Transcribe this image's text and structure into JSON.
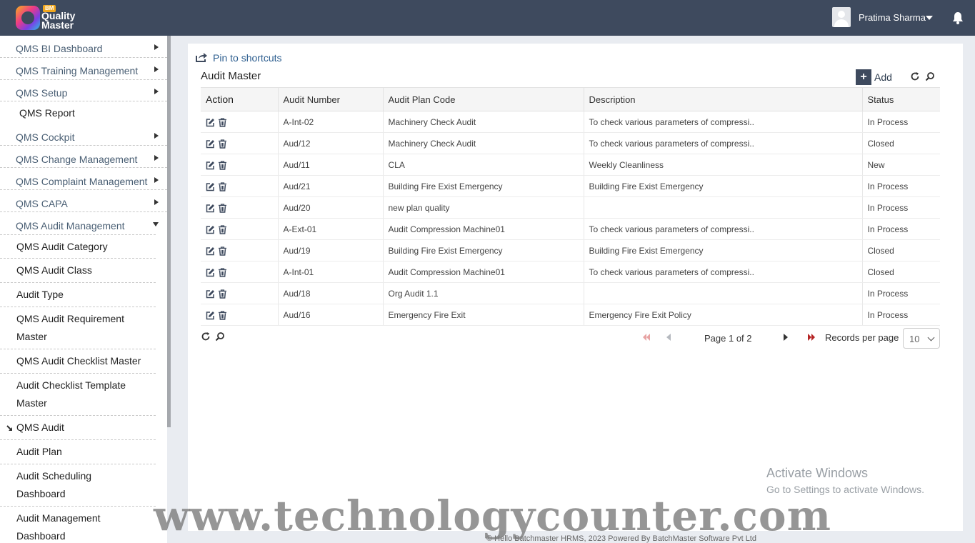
{
  "header": {
    "logo_badge": "BM",
    "logo_line1": "Quality",
    "logo_line2": "Master",
    "user_name": "Pratima Sharma",
    "icons": [
      "avatar-icon",
      "caret-down-icon",
      "bell-icon"
    ]
  },
  "sidebar": {
    "top_items": [
      {
        "label": "QMS BI Dashboard",
        "arrow": "right"
      },
      {
        "label": "QMS Training Management",
        "arrow": "right"
      },
      {
        "label": "QMS Setup",
        "arrow": "right"
      },
      {
        "label": "QMS Report",
        "arrow": "none"
      },
      {
        "label": "QMS Cockpit",
        "arrow": "right"
      },
      {
        "label": "QMS Change Management",
        "arrow": "right"
      },
      {
        "label": "QMS Complaint Management",
        "arrow": "right"
      },
      {
        "label": "QMS CAPA",
        "arrow": "right"
      },
      {
        "label": "QMS Audit Management",
        "arrow": "down"
      }
    ],
    "sub_items": [
      {
        "label": "QMS Audit Category"
      },
      {
        "label": "QMS Audit Class"
      },
      {
        "label": "Audit Type"
      },
      {
        "label": "QMS Audit Requirement",
        "label2": "Master"
      },
      {
        "label": "QMS Audit Checklist Master"
      },
      {
        "label": "Audit Checklist Template",
        "label2": "Master"
      },
      {
        "label": "QMS Audit",
        "active": true
      },
      {
        "label": "Audit Plan"
      },
      {
        "label": "Audit Scheduling",
        "label2": "Dashboard"
      },
      {
        "label": "Audit Management",
        "label2": "Dashboard"
      }
    ]
  },
  "main": {
    "pin_label": "Pin to shortcuts",
    "title": "Audit Master",
    "add_label": "Add",
    "table": {
      "headers": [
        "Action",
        "Audit Number",
        "Audit Plan Code",
        "Description",
        "Status"
      ],
      "rows": [
        [
          "A-Int-02",
          "Machinery Check Audit",
          "To check various parameters of compressi..",
          "In Process"
        ],
        [
          "Aud/12",
          "Machinery Check Audit",
          "To check various parameters of compressi..",
          "Closed"
        ],
        [
          "Aud/11",
          "CLA",
          "Weekly Cleanliness",
          "New"
        ],
        [
          "Aud/21",
          "Building Fire Exist Emergency",
          "Building Fire Exist Emergency",
          "In Process"
        ],
        [
          "Aud/20",
          "new plan quality",
          "",
          "In Process"
        ],
        [
          "A-Ext-01",
          "Audit Compression Machine01",
          "To check various parameters of compressi..",
          "In Process"
        ],
        [
          "Aud/19",
          "Building Fire Exist Emergency",
          "Building Fire Exist Emergency",
          "Closed"
        ],
        [
          "A-Int-01",
          "Audit Compression Machine01",
          "To check various parameters of compressi..",
          "Closed"
        ],
        [
          "Aud/18",
          "Org Audit 1.1",
          "",
          "In Process"
        ],
        [
          "Aud/16",
          "Emergency Fire Exit",
          "Emergency Fire Exit Policy",
          "In Process"
        ]
      ]
    },
    "pager": {
      "page_text": "Page 1 of 2",
      "records_label": "Records per page",
      "records_value": "10"
    }
  },
  "overlay": {
    "activate_title": "Activate Windows",
    "activate_sub": "Go to Settings to activate Windows.",
    "footer": "© Hello Batchmaster HRMS, 2023  Powered By BatchMaster Software Pvt Ltd",
    "watermark": "www.technologycounter.com"
  },
  "colors": {
    "header_bg": "#3e4a5e",
    "link": "#2d5e8f",
    "page_bg": "#e9ecf1"
  }
}
